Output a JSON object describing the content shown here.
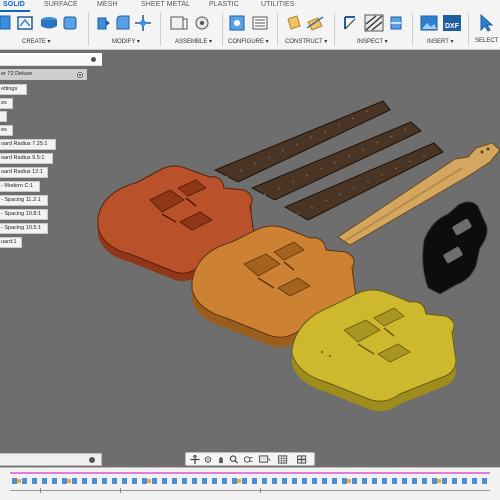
{
  "tabs": [
    {
      "label": "SOLID",
      "active": true
    },
    {
      "label": "SURFACE"
    },
    {
      "label": "MESH"
    },
    {
      "label": "SHEET METAL"
    },
    {
      "label": "PLASTIC"
    },
    {
      "label": "UTILITIES"
    }
  ],
  "groups": {
    "create": "CREATE ▾",
    "modify": "MODIFY ▾",
    "assemble": "ASSEMBLE ▾",
    "configure": "CONFIGURE ▾",
    "construct": "CONSTRUCT ▾",
    "inspect": "INSPECT ▾",
    "insert": "INSERT ▾",
    "select": "SELECT"
  },
  "browser": {
    "root": "er 72 Deluxe",
    "items": [
      "ettings",
      "es",
      "",
      "es",
      "oard Radius 7.25:1",
      "oard Radius 9.5:1",
      "oard Radius 12:1",
      "- Modern C:1",
      "- Spacing 11.2:1",
      "- Spacing 10.8:1",
      "- Spacing 10.5:1",
      "uard:1"
    ]
  },
  "colors": {
    "accent": "#0a66c2",
    "viewport": "#6e6e6e",
    "body_red": "#b9522b",
    "body_orange": "#cc8232",
    "body_yellow": "#cdb82e",
    "fretboard": "#4a3424",
    "neck": "#d4a760",
    "pickguard": "#0d0d0d"
  }
}
